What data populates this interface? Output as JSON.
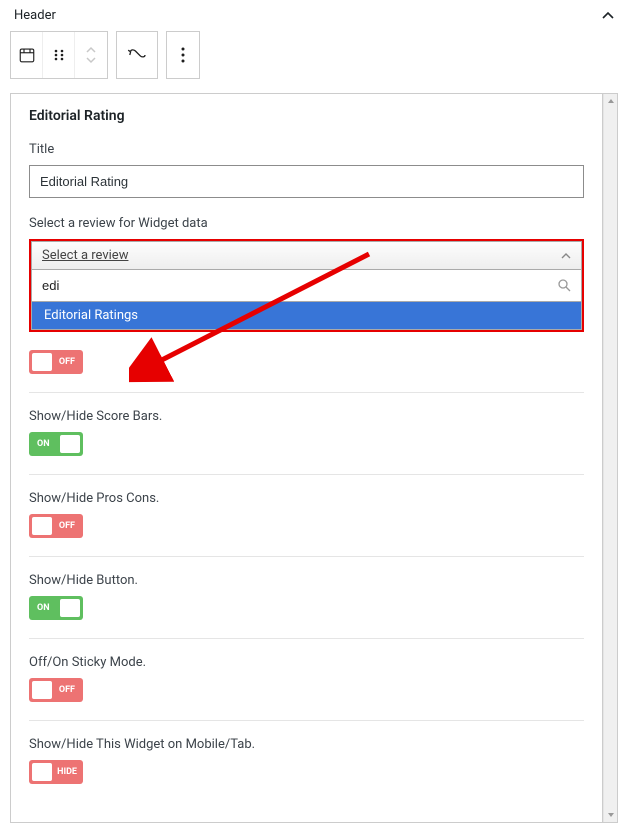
{
  "header": {
    "label": "Header"
  },
  "panel": {
    "title": "Editorial Rating",
    "title_field": {
      "label": "Title",
      "value": "Editorial Rating"
    },
    "review_field": {
      "label": "Select a review for Widget data",
      "selected": "Select a review",
      "search_value": "edi",
      "result": "Editorial Ratings"
    },
    "sections": [
      {
        "label_hidden": "",
        "state": "off",
        "text": "OFF"
      },
      {
        "label": "Show/Hide Score Bars.",
        "state": "on",
        "text": "ON"
      },
      {
        "label": "Show/Hide Pros Cons.",
        "state": "off",
        "text": "OFF"
      },
      {
        "label": "Show/Hide Button.",
        "state": "on",
        "text": "ON"
      },
      {
        "label": "Off/On Sticky Mode.",
        "state": "off",
        "text": "OFF"
      },
      {
        "label": "Show/Hide This Widget on Mobile/Tab.",
        "state": "hide",
        "text": "HIDE"
      }
    ]
  }
}
